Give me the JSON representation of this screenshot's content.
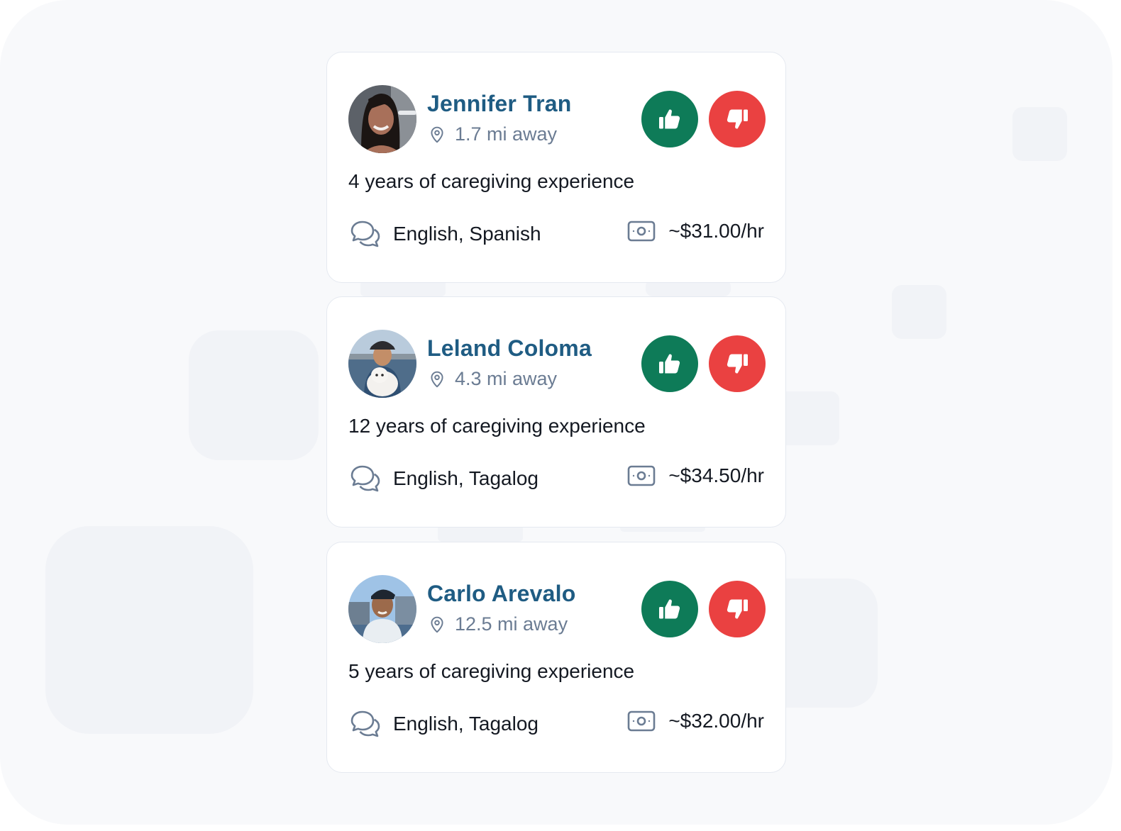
{
  "colors": {
    "name": "#1f5c83",
    "like": "#0e7b58",
    "dislike": "#ea4141",
    "muted": "#6b7c93"
  },
  "caregivers": [
    {
      "name": "Jennifer Tran",
      "distance": "1.7 mi away",
      "experience": "4 years of caregiving experience",
      "languages": "English, Spanish",
      "rate": "~$31.00/hr"
    },
    {
      "name": "Leland Coloma",
      "distance": "4.3 mi away",
      "experience": "12 years of caregiving experience",
      "languages": "English, Tagalog",
      "rate": "~$34.50/hr"
    },
    {
      "name": "Carlo Arevalo",
      "distance": "12.5 mi away",
      "experience": "5 years of caregiving experience",
      "languages": "English, Tagalog",
      "rate": "~$32.00/hr"
    }
  ],
  "icons": {
    "distance": "location-pin-icon",
    "languages": "chat-bubbles-icon",
    "rate": "money-icon",
    "like": "thumbs-up-icon",
    "dislike": "thumbs-down-icon"
  }
}
